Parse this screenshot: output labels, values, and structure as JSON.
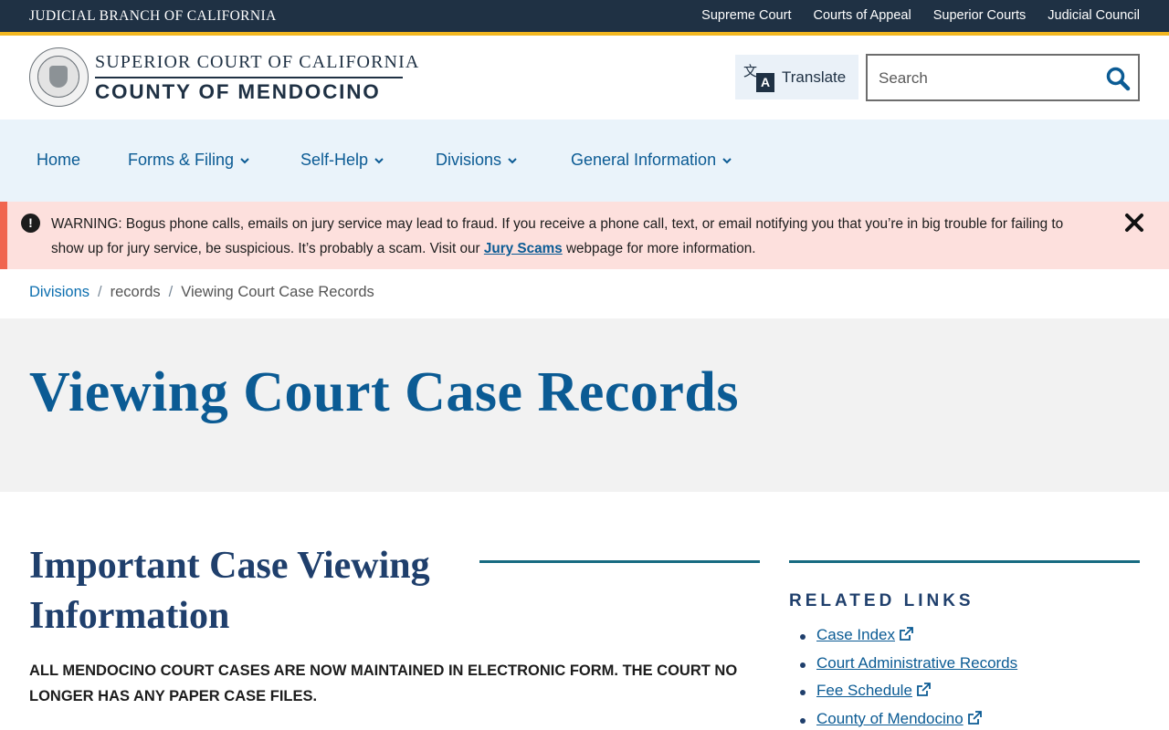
{
  "topbar": {
    "branch_title": "JUDICIAL BRANCH OF CALIFORNIA",
    "links": [
      "Supreme Court",
      "Courts of Appeal",
      "Superior Courts",
      "Judicial Council"
    ]
  },
  "header": {
    "court_line1": "SUPERIOR COURT OF CALIFORNIA",
    "court_line2": "COUNTY OF MENDOCINO",
    "seal_text": "JUDICIAL BRANCH OF CALIFORNIA",
    "translate_label": "Translate",
    "translate_glyph_1": "文",
    "translate_glyph_2": "A",
    "search_placeholder": "Search"
  },
  "nav": {
    "items": [
      {
        "label": "Home",
        "has_menu": false
      },
      {
        "label": "Forms & Filing",
        "has_menu": true
      },
      {
        "label": "Self-Help",
        "has_menu": true
      },
      {
        "label": "Divisions",
        "has_menu": true
      },
      {
        "label": "General Information",
        "has_menu": true
      }
    ]
  },
  "alert": {
    "icon_glyph": "!",
    "text_before": "WARNING: Bogus phone calls, emails on jury service may lead to fraud.  If you receive a phone call, text, or email notifying you that you’re in big trouble for failing to show up for jury service, be suspicious.  It’s probably a scam.  Visit our ",
    "link_text": "Jury Scams",
    "text_after": " webpage for more information."
  },
  "breadcrumb": {
    "items": [
      "Divisions",
      "records",
      "Viewing Court Case Records"
    ],
    "separator": "/"
  },
  "page": {
    "title": "Viewing Court Case Records"
  },
  "main": {
    "section_title": "Important Case Viewing Information",
    "notice": "ALL MENDOCINO COURT CASES ARE NOW MAINTAINED IN ELECTRONIC FORM.  THE COURT NO LONGER HAS ANY PAPER CASE FILES."
  },
  "sidebar": {
    "heading": "RELATED LINKS",
    "links": [
      {
        "label": "Case Index",
        "external": true
      },
      {
        "label": "Court Administrative Records",
        "external": false
      },
      {
        "label": "Fee Schedule",
        "external": true
      },
      {
        "label": "County of Mendocino",
        "external": true
      }
    ]
  },
  "colors": {
    "topbar": "#1f3144",
    "accent_gold": "#f2b720",
    "link_blue": "#0b5b94",
    "nav_bg": "#eaf3fa",
    "alert_bg": "#fde0dd",
    "alert_bar": "#f0654f",
    "rule_teal": "#176b81"
  }
}
